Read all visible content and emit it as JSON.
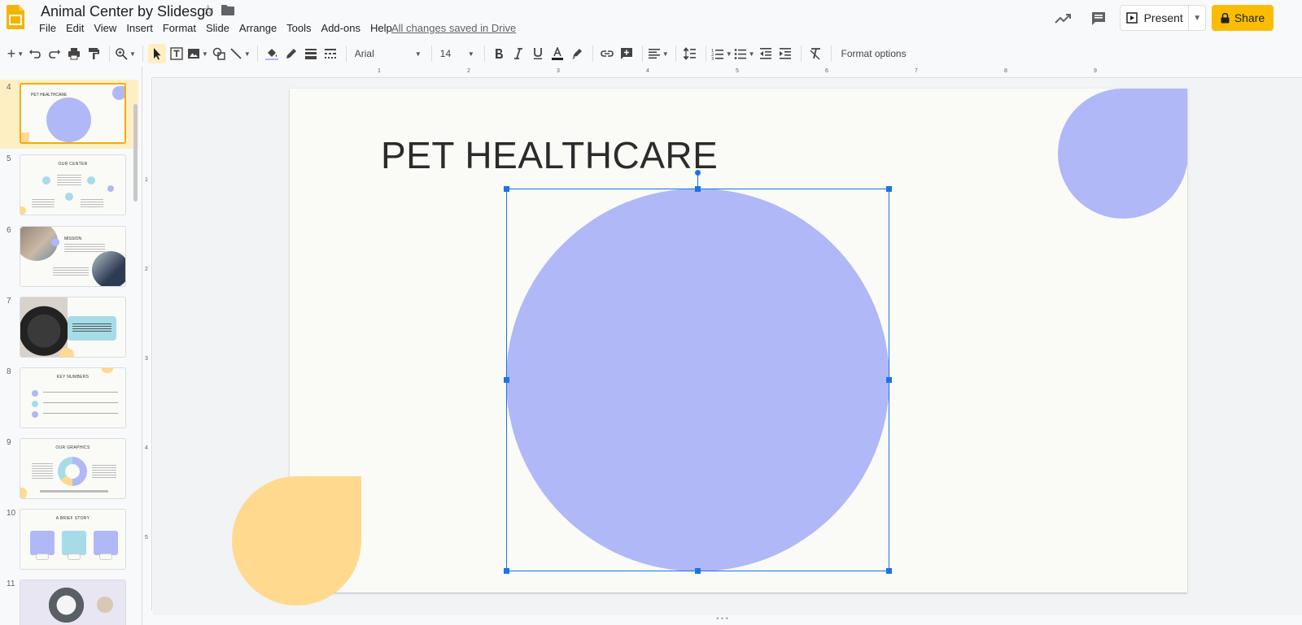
{
  "app": {
    "title": "Animal Center by Slidesgo",
    "saved_status": "All changes saved in Drive",
    "accent": "#fbbc04",
    "logo_icon": "google-slides-logo-icon"
  },
  "menu": [
    "File",
    "Edit",
    "View",
    "Insert",
    "Format",
    "Slide",
    "Arrange",
    "Tools",
    "Add-ons",
    "Help"
  ],
  "header": {
    "present_label": "Present",
    "share_label": "Share"
  },
  "toolbar": {
    "font": "Arial",
    "font_size": "14",
    "format_options": "Format options"
  },
  "filmstrip": {
    "slides": [
      {
        "number": "4",
        "title": "PET HEALTHCARE"
      },
      {
        "number": "5",
        "title": "OUR CENTER"
      },
      {
        "number": "6",
        "title": "MISSION"
      },
      {
        "number": "7",
        "title": ""
      },
      {
        "number": "8",
        "title": "KEY NUMBERS"
      },
      {
        "number": "9",
        "title": "OUR GRAPHICS"
      },
      {
        "number": "10",
        "title": "A BRIEF STORY"
      },
      {
        "number": "11",
        "title": ""
      }
    ]
  },
  "slide": {
    "title": "PET HEALTHCARE",
    "circle_color": "#b0b8f8",
    "drop_color": "#ffd98e"
  },
  "ruler": {
    "top": [
      "1",
      "2",
      "3",
      "4",
      "5",
      "6",
      "7",
      "8",
      "9"
    ],
    "left": [
      "1",
      "2",
      "3",
      "4",
      "5"
    ]
  }
}
